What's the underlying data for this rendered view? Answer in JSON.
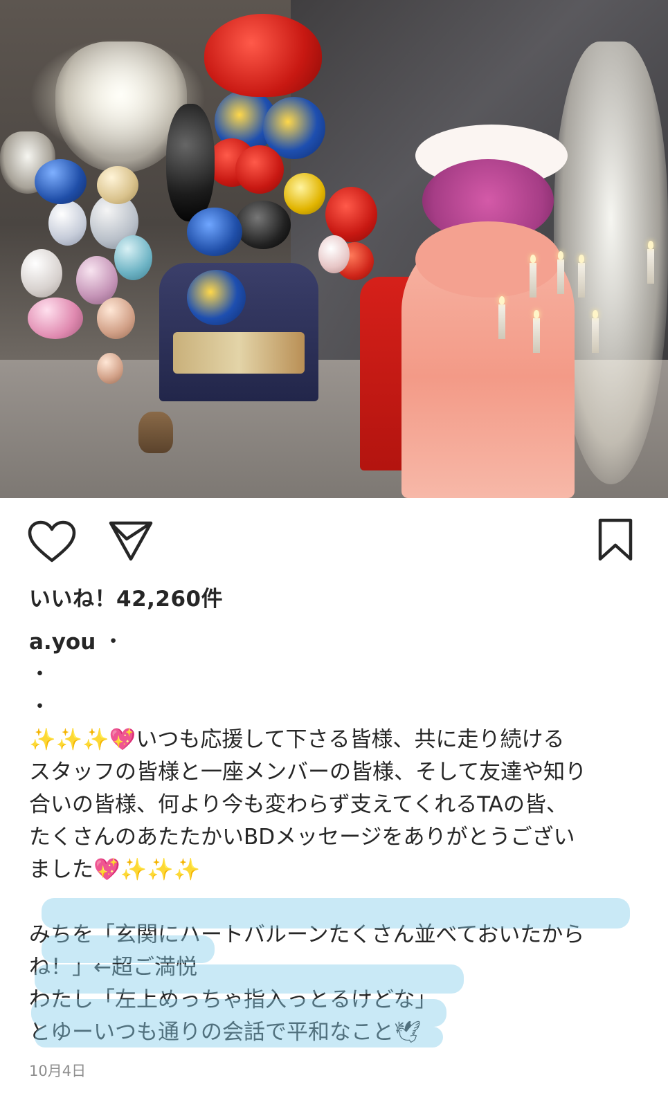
{
  "post": {
    "likes_text": "いいね！42,260件",
    "username": "a.you",
    "caption": {
      "first_line_after_user": "・",
      "dot_lines": [
        "・",
        "・"
      ],
      "lines": [
        "✨✨✨💖いつも応援して下さる皆様、共に走り続ける",
        "スタッフの皆様と一座メンバーの皆様、そして友達や知り",
        "合いの皆様、何より今も変わらず支えてくれるTAの皆、",
        "たくさんのあたたかいBDメッセージをありがとうござい",
        "ました💖✨✨✨"
      ],
      "dialogue": [
        "みちを「玄関にハートバルーンたくさん並べておいたから",
        "ね！」←超ご満悦",
        "わたし「左上めっちゃ指入っとるけどな」",
        "とゆーいつも通りの会話で平和なこと🕊"
      ]
    },
    "date": "10月4日"
  },
  "icons": {
    "like": "heart-outline-icon",
    "share": "paper-plane-icon",
    "save": "bookmark-outline-icon"
  },
  "colors": {
    "text": "#262626",
    "date": "#8e8e8e",
    "highlight": "#87ceeb"
  }
}
